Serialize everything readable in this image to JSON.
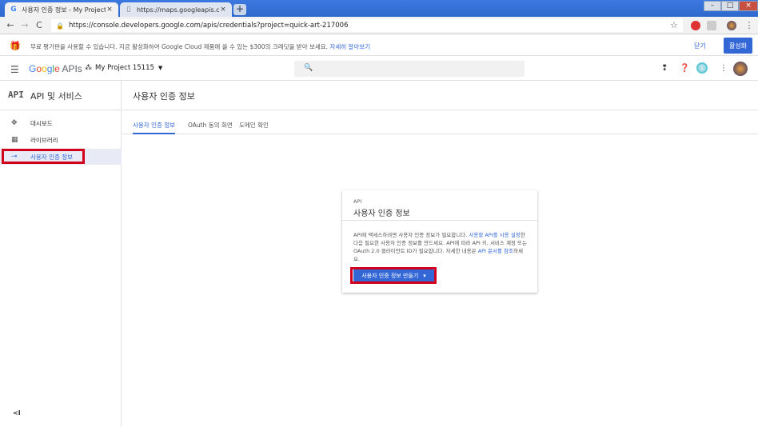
{
  "browser": {
    "tabs": [
      {
        "favicon": "G",
        "title": "사용자 인증 정보 - My Project",
        "close": "×"
      },
      {
        "favicon": "▯",
        "title": "https://maps.googleapis.com/m",
        "close": "×"
      }
    ],
    "new_tab": "+",
    "window_controls": {
      "minimize": "–",
      "maximize": "□",
      "close": "×"
    },
    "nav": {
      "back": "←",
      "forward": "→",
      "reload": "C"
    },
    "url": "https://console.developers.google.com/apis/credentials?project=quick-art-217006",
    "star": "☆",
    "menu": "⋮"
  },
  "promo": {
    "text": "무료 평가판을 사용할 수 있습니다. 지금 활성화하여 Google Cloud 제품에 쓸 수 있는 $300의 크레딧을 받아 보세요.",
    "link": "자세히 알아보기",
    "dismiss": "닫기",
    "activate": "활성화"
  },
  "header": {
    "logo_google": [
      "G",
      "o",
      "o",
      "g",
      "l",
      "e"
    ],
    "logo_apis": "APIs",
    "project": "My Project 15115",
    "project_caret": "▼",
    "notification_count": "1"
  },
  "sidebar": {
    "logo": "API",
    "title": "API 및 서비스",
    "items": [
      {
        "icon": "✥",
        "label": "대시보드"
      },
      {
        "icon": "▦",
        "label": "라이브러리"
      },
      {
        "icon": "⊸",
        "label": "사용자 인증 정보"
      }
    ],
    "collapse": "<I"
  },
  "main": {
    "title": "사용자 인증 정보",
    "tabs": [
      "사용자 인증 정보",
      "OAuth 동의 화면",
      "도메인 확인"
    ]
  },
  "card": {
    "kicker": "API",
    "title": "사용자 인증 정보",
    "body_1": "API에 액세스하려면 사용자 인증 정보가 필요합니다. ",
    "body_link_1": "사용할 API를 사용 설정",
    "body_2": "한 다음 필요한 사용자 인증 정보를 만드세요. API에 따라 API 키, 서비스 계정 또는 OAuth 2.0 클라이언트 ID가 필요합니다. 자세한 내용은 ",
    "body_link_2": "API 문서를 참조",
    "body_3": "하세요.",
    "button": "사용자 인증 정보 만들기",
    "button_caret": "▾"
  }
}
